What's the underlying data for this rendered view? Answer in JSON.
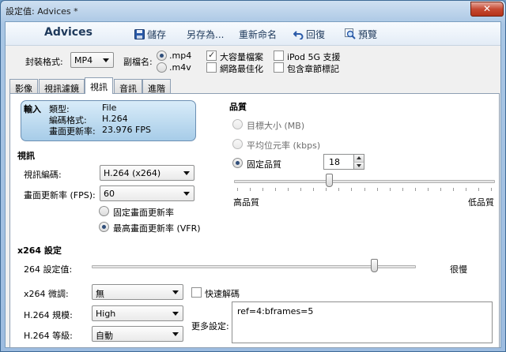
{
  "window": {
    "title": "設定值: Advices *",
    "close_glyph": "✕"
  },
  "toolbar": {
    "preset_name": "Advices",
    "save_label": "儲存",
    "save_as_label": "另存為...",
    "rename_label": "重新命名",
    "revert_label": "回復",
    "preview_label": "預覽"
  },
  "container": {
    "format_label": "封裝格式:",
    "format_value": "MP4",
    "ext_label": "副檔名:",
    "ext_options": [
      ".mp4",
      ".m4v"
    ],
    "ext_selected": ".mp4",
    "large_file_label": "大容量檔案",
    "large_file_checked": true,
    "web_optimized_label": "網路最佳化",
    "web_optimized_checked": false,
    "ipod_label": "iPod 5G 支援",
    "ipod_checked": false,
    "chapters_label": "包含章節標記",
    "chapters_checked": false
  },
  "tabs": [
    {
      "label": "影像",
      "active": false
    },
    {
      "label": "視訊濾鏡",
      "active": false
    },
    {
      "label": "視訊",
      "active": true
    },
    {
      "label": "音訊",
      "active": false
    },
    {
      "label": "進階",
      "active": false
    }
  ],
  "source": {
    "heading": "輸入",
    "type_label": "類型:",
    "type_value": "File",
    "codec_label": "編碼格式:",
    "codec_value": "H.264",
    "fps_label": "畫面更新率:",
    "fps_value": "23.976 FPS"
  },
  "video": {
    "section_title": "視訊",
    "encoder_label": "視訊編碼:",
    "encoder_value": "H.264 (x264)",
    "framerate_label": "畫面更新率 (FPS):",
    "framerate_value": "60",
    "cfr_label": "固定畫面更新率",
    "vfr_label": "最高畫面更新率 (VFR)",
    "framerate_mode": "vfr"
  },
  "quality": {
    "section_title": "品質",
    "target_size_label": "目標大小 (MB)",
    "avg_bitrate_label": "平均位元率 (kbps)",
    "constant_quality_label": "固定品質",
    "mode": "constant_quality",
    "rf_value": "18",
    "slider_fraction": 0.36,
    "high_quality_label": "高品質",
    "low_quality_label": "低品質"
  },
  "x264": {
    "section_title": "x264 設定",
    "preset_label": "264 設定值:",
    "preset_slider_fraction": 0.88,
    "preset_right_label": "很慢",
    "tune_label": "x264 微調:",
    "tune_value": "無",
    "fast_decode_label": "快速解碼",
    "fast_decode_checked": false,
    "profile_label": "H.264 規模:",
    "profile_value": "High",
    "level_label": "H.264 等級:",
    "level_value": "自動",
    "advanced_label": "更多設定:",
    "advanced_value": "ref=4:bframes=5"
  },
  "colors": {
    "title_bar": "#a9c6e4",
    "close_button": "#c64a33",
    "source_box": "#a7cce8",
    "toolbar_text": "#1e395b"
  }
}
